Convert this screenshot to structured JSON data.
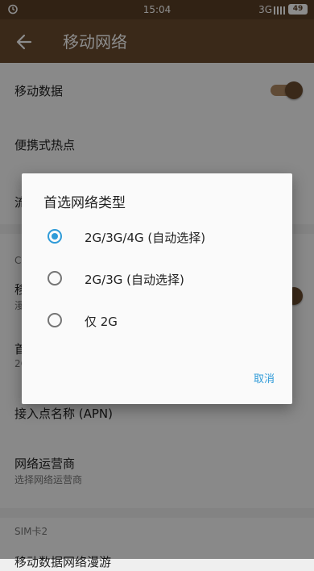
{
  "statusbar": {
    "time": "15:04",
    "network": "3G",
    "battery": "49"
  },
  "appbar": {
    "title": "移动网络"
  },
  "settings": {
    "mobile_data": "移动数据",
    "hotspot": "便携式热点",
    "row_partial_1": "流",
    "section_partial": "C",
    "row_partial_2": "移",
    "row_partial_2_sub": "漫",
    "row_partial_3": "首",
    "row_partial_3_sub": "2G",
    "apn": "接入点名称 (APN)",
    "operator": "网络运营商",
    "operator_sub": "选择网络运营商",
    "sim2_section": "SIM卡2",
    "row_bottom": "移动数据网络漫游"
  },
  "dialog": {
    "title": "首选网络类型",
    "options": [
      {
        "label": "2G/3G/4G (自动选择)",
        "selected": true
      },
      {
        "label": "2G/3G (自动选择)",
        "selected": false
      },
      {
        "label": "仅 2G",
        "selected": false
      }
    ],
    "cancel": "取消"
  },
  "colors": {
    "accent": "#2f9bd8",
    "appbar": "#6b4b2e"
  }
}
